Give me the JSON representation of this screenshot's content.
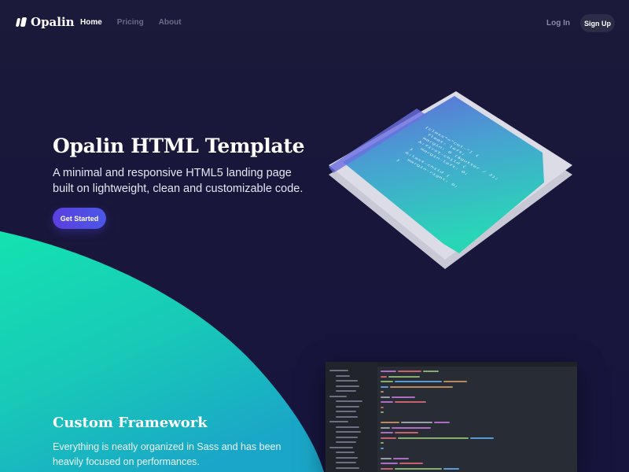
{
  "brand": {
    "name": "Opalin"
  },
  "nav": {
    "items": [
      "Home",
      "Pricing",
      "About"
    ],
    "active": "Home"
  },
  "auth": {
    "login_label": "Log In",
    "signup_label": "Sign Up"
  },
  "hero": {
    "title": "Opalin HTML Template",
    "subtitle": "A minimal and responsive HTML5 landing page built on lightweight, clean and customizable code.",
    "cta_label": "Get Started",
    "code_lines": [
      "[class*=\"col-\"] {",
      "float: left;",
      "margin: 0 ($gutter / 2);",
      "&:first-child {",
      "margin-left: 0;",
      "}",
      "&:last-child {",
      "margin-right: 0;",
      "}"
    ]
  },
  "feature": {
    "title": "Custom Framework",
    "text": "Everything is neatly organized in Sass and has been heavily focused on performances."
  },
  "colors": {
    "background": "#1b1939",
    "accent_teal": "#1fd6b4",
    "accent_purple": "#5b3fe0"
  }
}
